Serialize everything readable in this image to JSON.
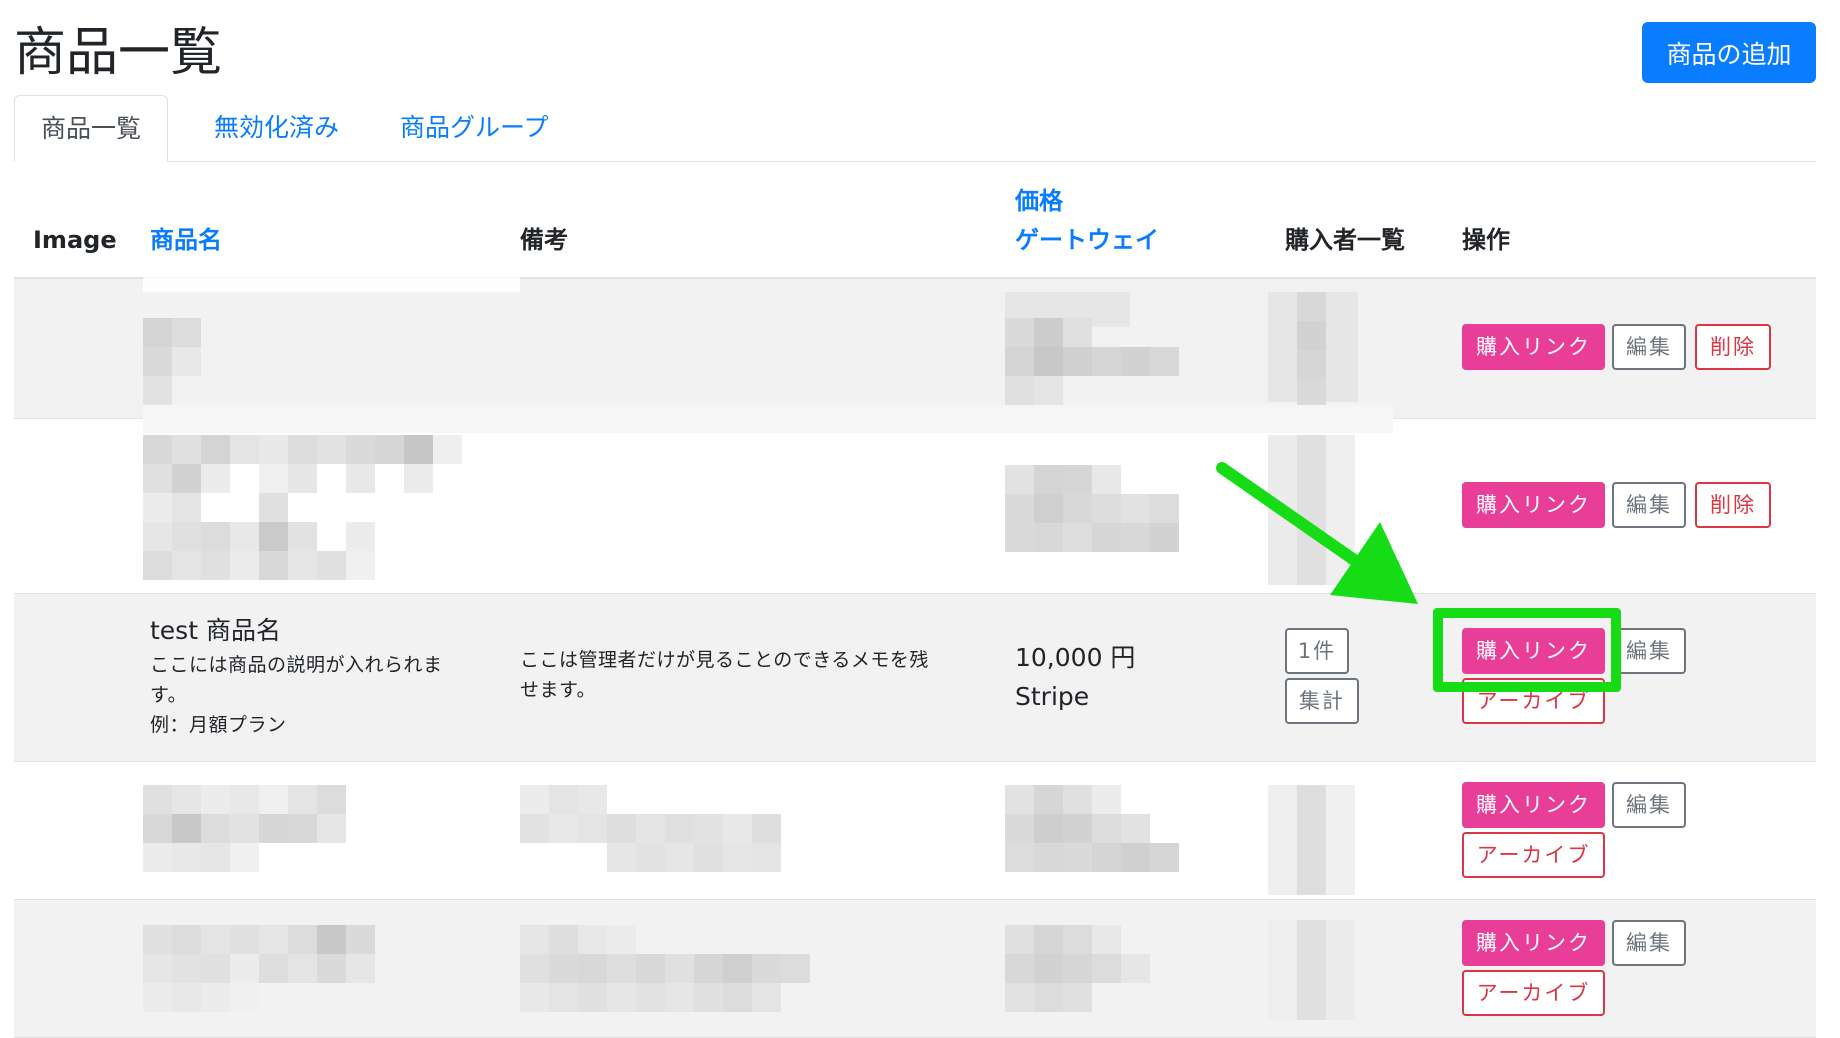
{
  "page": {
    "title": "商品一覧",
    "add_button": "商品の追加"
  },
  "tabs": [
    {
      "label": "商品一覧",
      "active": true
    },
    {
      "label": "無効化済み",
      "active": false
    },
    {
      "label": "商品グループ",
      "active": false
    }
  ],
  "table": {
    "headers": {
      "image": "Image",
      "name": "商品名",
      "memo": "備考",
      "price": "価格",
      "gateway": "ゲートウェイ",
      "buyers": "購入者一覧",
      "actions": "操作"
    },
    "rows": [
      {
        "buy": "購入リンク",
        "edit": "編集",
        "delete": "削除"
      },
      {
        "buy": "購入リンク",
        "edit": "編集",
        "delete": "削除"
      },
      {
        "name": "test 商品名",
        "desc_line1": "ここには商品の説明が入れられま",
        "desc_line2": "す。",
        "desc_line3": "例：月額プラン",
        "memo_line1": "ここは管理者だけが見ることのできるメモを残",
        "memo_line2": "せます。",
        "price": "10,000 円",
        "gateway": "Stripe",
        "buyer_count": "1件",
        "aggregate": "集計",
        "buy": "購入リンク",
        "edit": "編集",
        "archive": "アーカイブ"
      },
      {
        "buy": "購入リンク",
        "edit": "編集",
        "archive": "アーカイブ"
      },
      {
        "buy": "購入リンク",
        "edit": "編集",
        "archive": "アーカイブ"
      }
    ]
  },
  "colors": {
    "primary": "#0a7cff",
    "buy_pink": "#e83e98",
    "danger": "#dc3545",
    "secondary": "#6c757d",
    "annotation_green": "#16dc16"
  }
}
